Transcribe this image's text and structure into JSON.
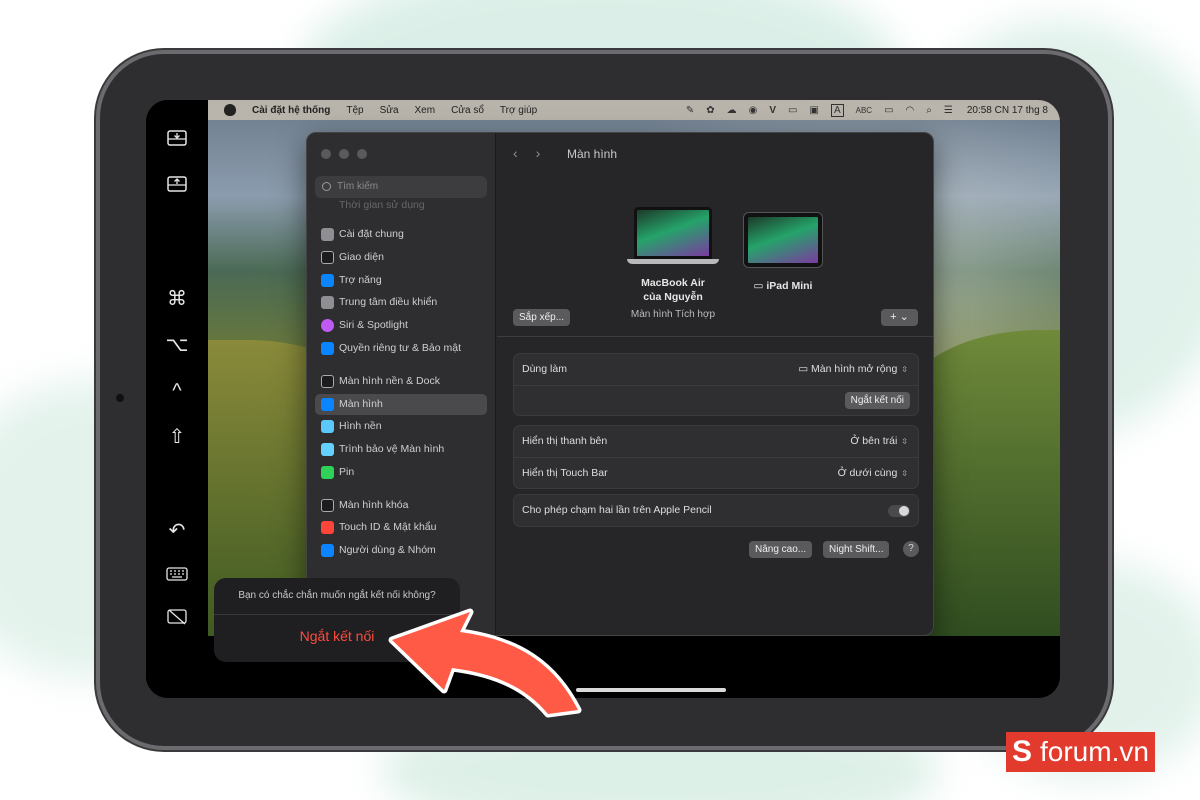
{
  "colors": {
    "accent_arrow": "#ff5a45",
    "destructive": "#ff4b3e",
    "brand_red": "#e23b2e",
    "window_bg": "#262628"
  },
  "menubar": {
    "app": "Cài đặt hệ thống",
    "items": [
      "Tệp",
      "Sửa",
      "Xem",
      "Cửa sổ",
      "Trợ giúp"
    ],
    "input_label": "A",
    "input_text": "ABC",
    "clock": "20:58 CN 17 thg 8"
  },
  "sidecar": {
    "icons": [
      "download-tray-icon",
      "upload-tray-icon",
      "command-key-icon",
      "option-key-icon",
      "control-key-icon",
      "shift-key-icon",
      "undo-icon",
      "keyboard-icon",
      "disconnect-display-icon"
    ]
  },
  "sidebar": {
    "search_placeholder": "Tìm kiếm",
    "cut_item": "Thời gian sử dụng",
    "items": [
      {
        "label": "Cài đặt chung",
        "color": "#8e8e93"
      },
      {
        "label": "Giao diện",
        "color": "#1c1c1e"
      },
      {
        "label": "Trợ năng",
        "color": "#0a84ff"
      },
      {
        "label": "Trung tâm điều khiển",
        "color": "#8e8e93"
      },
      {
        "label": "Siri & Spotlight",
        "color": "#bf5af2"
      },
      {
        "label": "Quyền riêng tư & Bảo mật",
        "color": "#0a84ff"
      },
      {
        "label": "Màn hình nền & Dock",
        "color": "#1c1c1e"
      },
      {
        "label": "Màn hình",
        "color": "#0a84ff"
      },
      {
        "label": "Hình nền",
        "color": "#5ac8fa"
      },
      {
        "label": "Trình bảo vệ Màn hình",
        "color": "#64d2ff"
      },
      {
        "label": "Pin",
        "color": "#30d158"
      },
      {
        "label": "Màn hình khóa",
        "color": "#1c1c1e"
      },
      {
        "label": "Touch ID & Mật khẩu",
        "color": "#ff453a"
      },
      {
        "label": "Người dùng & Nhóm",
        "color": "#0a84ff"
      }
    ]
  },
  "main": {
    "title": "Màn hình",
    "devices": [
      {
        "name_line1": "MacBook Air",
        "name_line2": "của Nguyễn",
        "subtitle": "Màn hình Tích hợp"
      },
      {
        "name": "iPad Mini"
      }
    ],
    "arrange_button": "Sắp xếp...",
    "add_button": "+ ⌄",
    "use_as_label": "Dùng làm",
    "use_as_value": "Màn hình mở rộng",
    "disconnect_button": "Ngắt kết nối",
    "sidebar_label": "Hiển thị thanh bên",
    "sidebar_value": "Ở bên trái",
    "touchbar_label": "Hiển thị Touch Bar",
    "touchbar_value": "Ở dưới cùng",
    "pencil_label": "Cho phép chạm hai lần trên Apple Pencil",
    "pencil_enabled": false,
    "advanced_button": "Nâng cao...",
    "nightshift_button": "Night Shift...",
    "help": "?"
  },
  "popover": {
    "question": "Bạn có chắc chắn muốn ngắt kết nối không?",
    "action": "Ngắt kết nối"
  },
  "brand": {
    "s": "S",
    "text": "forum.vn"
  }
}
